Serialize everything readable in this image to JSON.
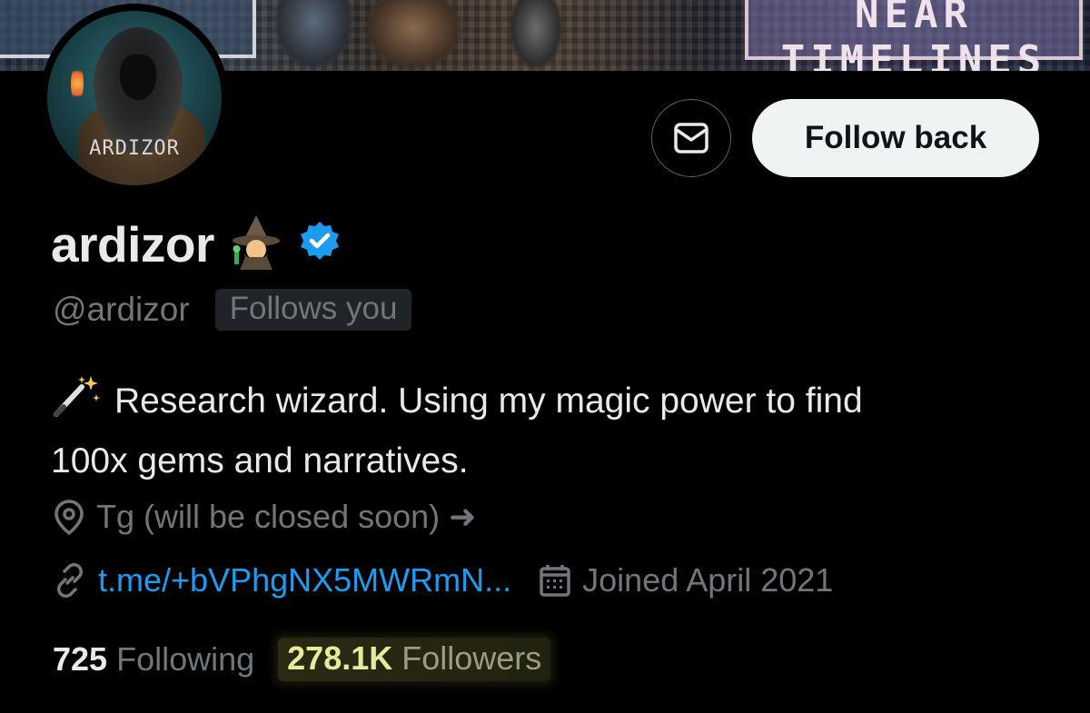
{
  "banner": {
    "sign_text": "NEAR TIMELINES"
  },
  "avatar": {
    "label": "ARDIZOR"
  },
  "actions": {
    "message_icon": "mail-icon",
    "follow_back_label": "Follow back"
  },
  "profile": {
    "display_name": "ardizor",
    "name_emoji": "🧙‍♂️",
    "verified_icon": "verified-badge-icon",
    "handle": "@ardizor",
    "follows_you": "Follows you",
    "bio_emoji": "🪄",
    "bio_line1": "Research wizard. Using my magic power to find",
    "bio_line2": "100x gems and narratives.",
    "location": "Tg (will be closed soon) ➜",
    "link": "t.me/+bVPhgNX5MWRmN...",
    "joined": "Joined April 2021"
  },
  "stats": {
    "following_count": "725",
    "following_label": "Following",
    "followers_count": "278.1K",
    "followers_label": "Followers"
  },
  "colors": {
    "background": "#000000",
    "text_primary": "#e7e9ea",
    "text_secondary": "#71767b",
    "link": "#1d9bf0",
    "verified": "#1d9bf0",
    "button_bg": "#eff3f4",
    "highlight": "#e6eb9c"
  }
}
